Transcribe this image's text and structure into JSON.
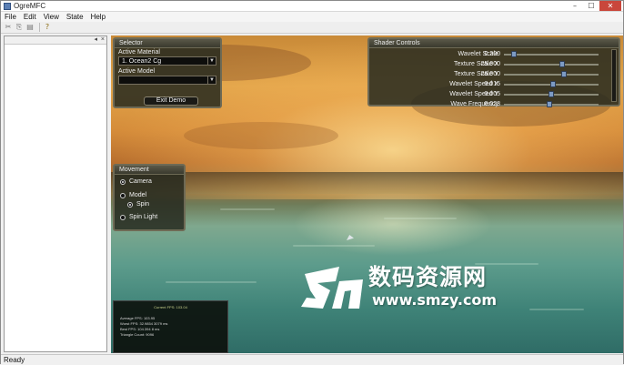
{
  "window": {
    "title": "OgreMFC",
    "controls": [
      "–",
      "☐",
      "✕"
    ]
  },
  "menu": [
    "File",
    "Edit",
    "View",
    "State",
    "Help"
  ],
  "toolbar": {
    "icons": [
      "cut-icon",
      "copy-icon",
      "paste-icon",
      "help-icon"
    ],
    "glyphs": [
      "✂",
      "⎘",
      "▤",
      "?"
    ]
  },
  "side_panel": {
    "buttons": [
      "◂",
      "×"
    ]
  },
  "selector": {
    "title": "Selector",
    "material_label": "Active Material",
    "material_value": "1. Ocean2 Cg",
    "model_label": "Active Model",
    "model_value": "",
    "exit_button": "Exit Demo"
  },
  "shader_controls": {
    "title": "Shader Controls",
    "rows": [
      {
        "name": "Wavelet Scale",
        "value": "0.200",
        "level": 0.08
      },
      {
        "name": "Texture Scale X",
        "value": "25.000",
        "level": 0.62
      },
      {
        "name": "Texture Scale Y",
        "value": "26.000",
        "level": 0.64
      },
      {
        "name": "Wavelet Speed X",
        "value": "0.015",
        "level": 0.52
      },
      {
        "name": "Wavelet Speed Y",
        "value": "0.005",
        "level": 0.5
      },
      {
        "name": "Wave Frequency",
        "value": "0.028",
        "level": 0.48
      }
    ]
  },
  "movement": {
    "title": "Movement",
    "options": [
      {
        "label": "Camera",
        "selected": true
      },
      {
        "label": "Model",
        "selected": false
      },
      {
        "label": "Spin",
        "selected": true
      },
      {
        "label": "Spin Light",
        "selected": false
      }
    ]
  },
  "stats": {
    "title": "Current FPS: 103.04",
    "lines": [
      "Average FPS: 103.95",
      "Worst FPS: 32.9854 3079 ms",
      "Best FPS: 104.394 8 ms",
      "Triangle Count: 9096"
    ]
  },
  "watermark": {
    "chinese": "数码资源网",
    "url": "www.smzy.com"
  },
  "status": "Ready",
  "colors": {
    "knob": "#7d9bc4",
    "panel": "#262a20",
    "titlebar_close": "#c9473b"
  }
}
